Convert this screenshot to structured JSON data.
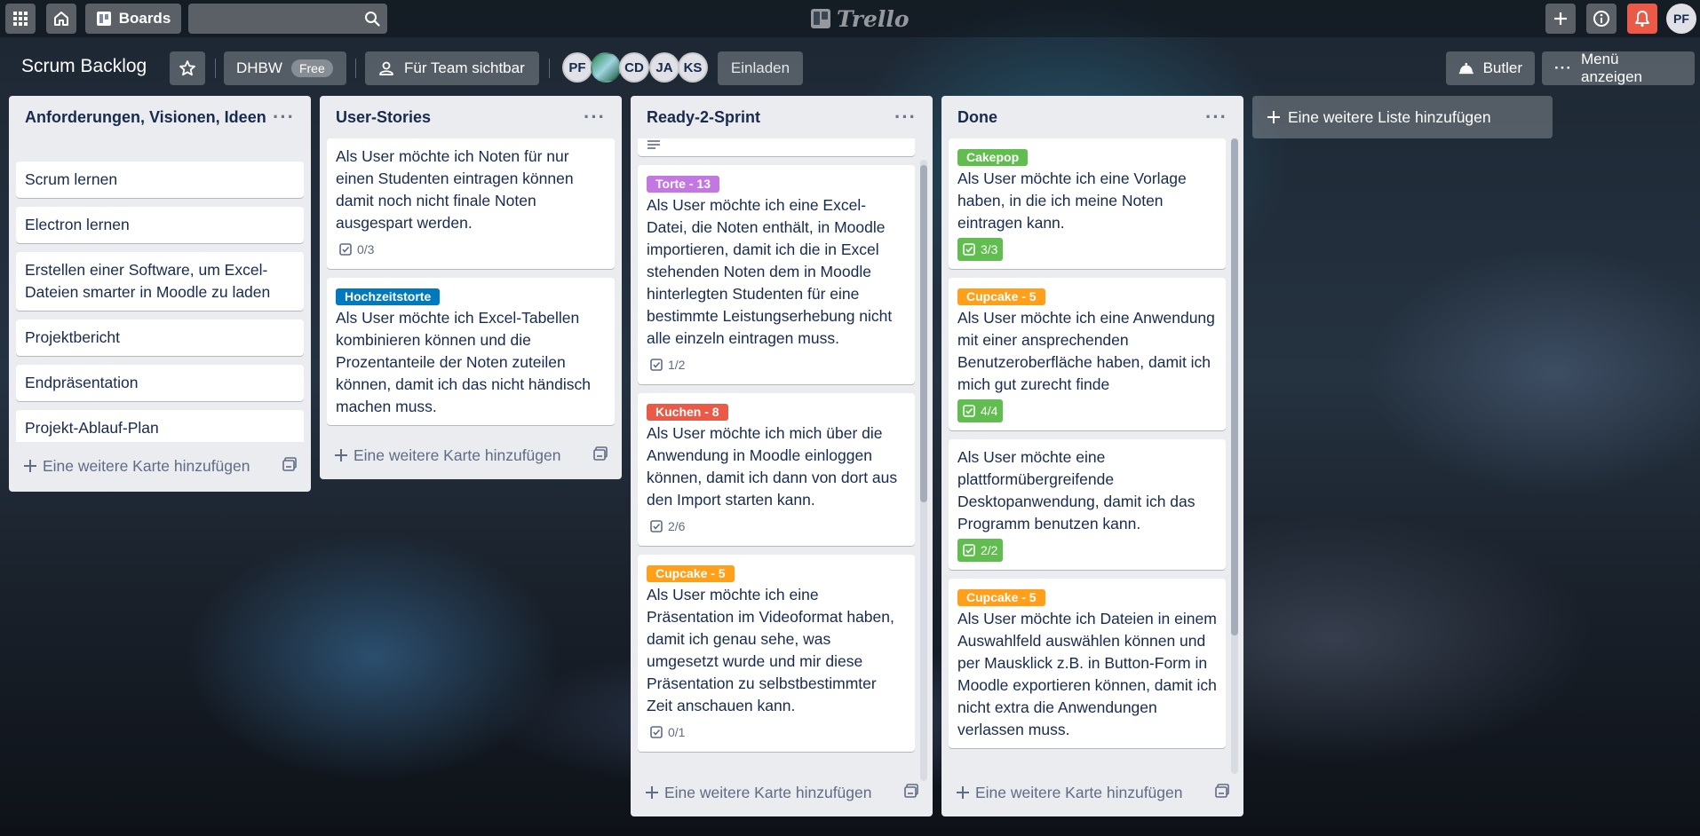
{
  "topbar": {
    "boards_label": "Boards",
    "search_value": "",
    "logo_text": "Trello",
    "user_initials": "PF"
  },
  "board": {
    "title": "Scrum Backlog",
    "team_name": "DHBW",
    "team_badge": "Free",
    "visibility_label": "Für Team sichtbar",
    "members": [
      "PF",
      "",
      "CD",
      "JA",
      "KS"
    ],
    "invite_label": "Einladen",
    "butler_label": "Butler",
    "menu_label": "Menü anzeigen"
  },
  "colors": {
    "green": "#61bd4f",
    "orange": "#ff9f1a",
    "red": "#eb5a46",
    "purple": "#c377e0",
    "blue": "#0079bf",
    "notification": "#eb5a46"
  },
  "lists": [
    {
      "title": "Anforderungen, Visionen, Ideen",
      "cards": [
        {
          "text": "Scrum lernen"
        },
        {
          "text": "Electron lernen"
        },
        {
          "text": "Erstellen einer Software, um Excel-Dateien smarter in Moodle zu laden"
        },
        {
          "text": "Projektbericht"
        },
        {
          "text": "Endpräsentation"
        },
        {
          "text": "Projekt-Ablauf-Plan"
        }
      ],
      "add_card_label": "Eine weitere Karte hinzufügen"
    },
    {
      "title": "User-Stories",
      "cards": [
        {
          "text": "Als User möchte ich Noten für nur einen Studenten eintragen können damit noch nicht finale Noten ausgespart werden.",
          "checklist": "0/3"
        },
        {
          "label": "Hochzeitstorte",
          "label_color": "blue",
          "text": "Als User möchte ich Excel-Tabellen kombinieren können und die Prozentanteile der Noten zuteilen können, damit ich das nicht händisch machen muss."
        }
      ],
      "add_card_label": "Eine weitere Karte hinzufügen"
    },
    {
      "title": "Ready-2-Sprint",
      "cards": [
        {
          "label": "Torte - 13",
          "label_color": "purple",
          "text": "Als User möchte ich eine Excel-Datei, die Noten enthält, in Moodle importieren, damit ich die in Excel stehenden Noten dem in Moodle hinterlegten Studenten für eine bestimmte Leistungserhebung nicht alle einzeln eintragen muss.",
          "checklist": "1/2"
        },
        {
          "label": "Kuchen - 8",
          "label_color": "red",
          "text": "Als User möchte ich mich über die Anwendung in Moodle einloggen können, damit ich dann von dort aus den Import starten kann.",
          "checklist": "2/6"
        },
        {
          "label": "Cupcake - 5",
          "label_color": "orange",
          "text": "Als User möchte ich eine Präsentation im Videoformat haben, damit ich genau sehe, was umgesetzt wurde und mir diese Präsentation zu selbstbestimmter Zeit anschauen kann.",
          "checklist": "0/1"
        }
      ],
      "add_card_label": "Eine weitere Karte hinzufügen"
    },
    {
      "title": "Done",
      "cards": [
        {
          "label": "Cakepop",
          "label_color": "green",
          "text": "Als User möchte ich eine Vorlage haben, in die ich meine Noten eintragen kann.",
          "checklist": "3/3"
        },
        {
          "label": "Cupcake - 5",
          "label_color": "orange",
          "text": "Als User möchte ich eine Anwendung mit einer ansprechenden Benutzeroberfläche haben, damit ich mich gut zurecht finde",
          "checklist": "4/4"
        },
        {
          "text": "Als User möchte eine plattformübergreifende Desktopanwendung, damit ich das Programm benutzen kann.",
          "checklist": "2/2"
        },
        {
          "label": "Cupcake - 5",
          "label_color": "orange",
          "text": "Als User möchte ich Dateien in einem Auswahlfeld auswählen können und per Mausklick z.B. in Button-Form in Moodle exportieren können, damit ich nicht extra die Anwendungen verlassen muss."
        }
      ],
      "add_card_label": "Eine weitere Karte hinzufügen"
    }
  ],
  "add_list_label": "Eine weitere Liste hinzufügen"
}
